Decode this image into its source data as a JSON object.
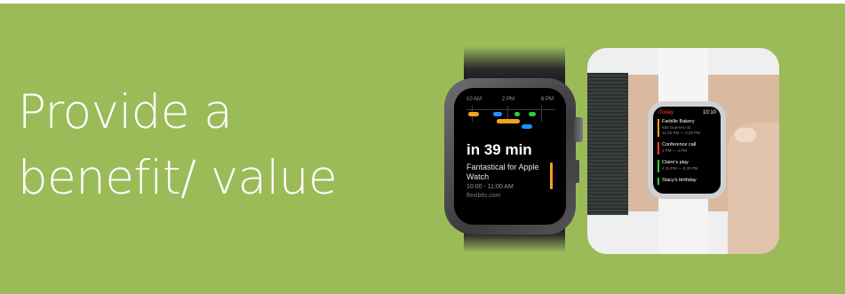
{
  "headline": {
    "line1": "Provide a",
    "line2": "benefit/ value"
  },
  "watch_left": {
    "timeline_labels": [
      "10 AM",
      "2 PM",
      "6 PM"
    ],
    "countdown": "in 39 min",
    "event_title": "Fantastical for Apple Watch",
    "event_time": "10:00 - 11:00 AM",
    "event_url": "flexibits.com"
  },
  "watch_right": {
    "back_label": "‹Today",
    "clock": "10:10",
    "events": [
      {
        "title": "Farbille Bakery",
        "sub": "930 Guerrero St",
        "sub2": "12:20 PM — 2:20 PM",
        "color": "#f7a21b"
      },
      {
        "title": "Conference call",
        "sub": "3 PM — 4 PM",
        "sub2": "",
        "color": "#ff3b30"
      },
      {
        "title": "Claire's play",
        "sub": "4:15 PM — 5:30 PM",
        "sub2": "",
        "color": "#2ecc40"
      },
      {
        "title": "Stacy's birthday",
        "sub": "",
        "sub2": "",
        "color": "#2ecc40"
      }
    ]
  },
  "colors": {
    "background": "#9bbb59",
    "text": "#ffffff",
    "accent_orange": "#f7a21b"
  },
  "icons": {
    "timeline": "timeline-chart-icon",
    "crown": "digital-crown-icon"
  }
}
